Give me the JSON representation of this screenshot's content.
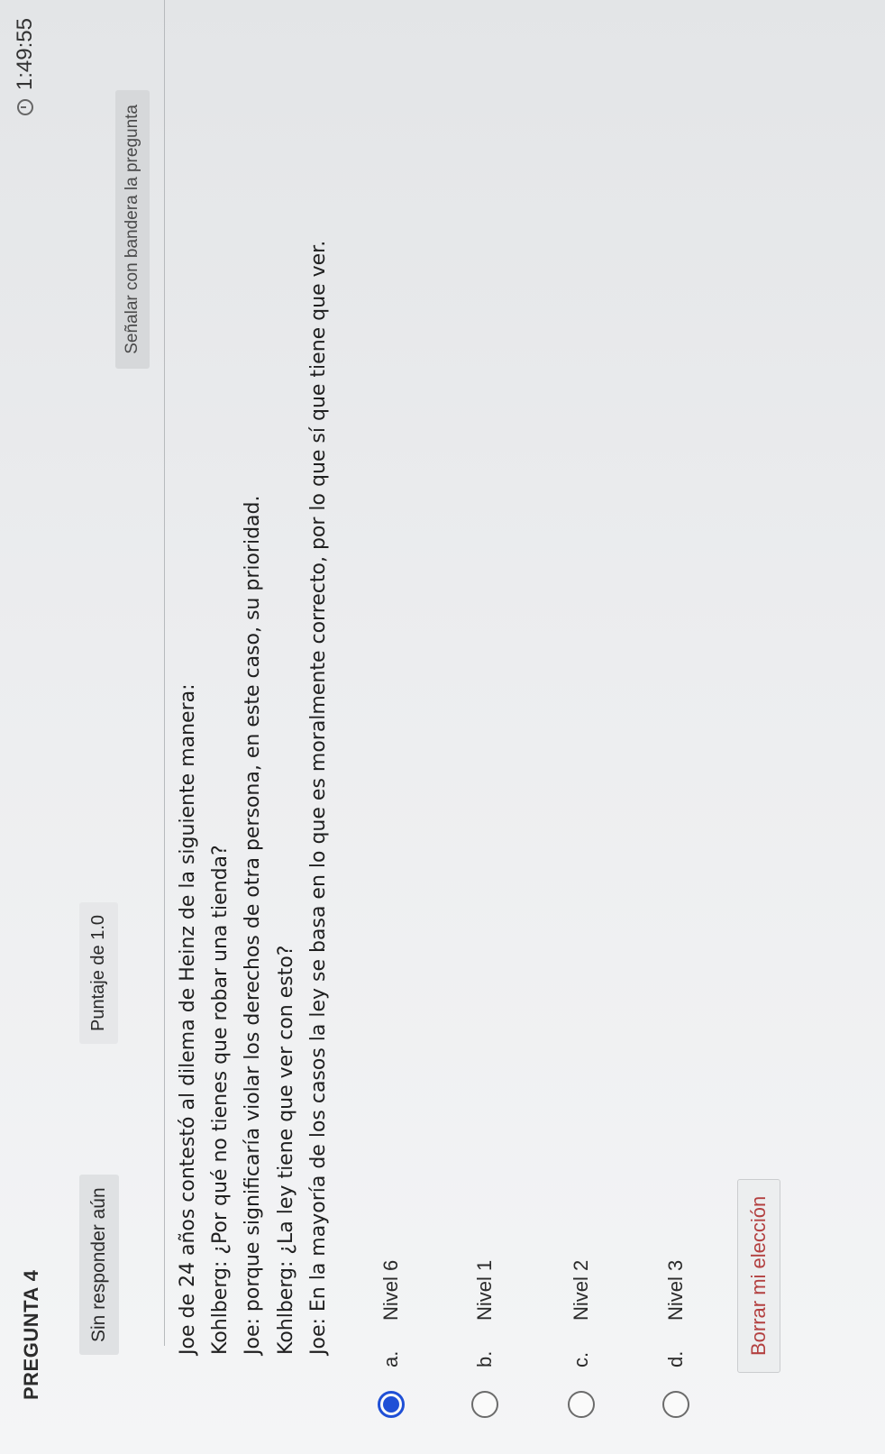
{
  "header": {
    "question_number": "PREGUNTA 4",
    "timer": "1:49:55",
    "timer_icon": "clock-icon"
  },
  "meta": {
    "status": "Sin responder aún",
    "points": "Puntaje de 1.0",
    "flag_label": "Señalar con bandera la pregunta"
  },
  "question": {
    "lines": [
      "Joe de 24 años contestó al dilema de Heinz de la siguiente manera:",
      "Kohlberg: ¿Por qué no tienes que robar una tienda?",
      "Joe: porque significaría violar los derechos de otra persona, en este caso, su prioridad.",
      "Kohlberg: ¿La ley tiene que ver con esto?",
      "Joe: En la mayoría de los casos la ley se basa en lo que es moralmente correcto, por lo que sí que tiene que ver."
    ]
  },
  "options": [
    {
      "letter": "a.",
      "label": "Nivel 6",
      "selected": true
    },
    {
      "letter": "b.",
      "label": "Nivel 1",
      "selected": false
    },
    {
      "letter": "c.",
      "label": "Nivel 2",
      "selected": false
    },
    {
      "letter": "d.",
      "label": "Nivel 3",
      "selected": false
    }
  ],
  "actions": {
    "clear_choice": "Borrar mi elección"
  },
  "colors": {
    "accent": "#1f4fd6",
    "clear_text": "#b34040"
  }
}
